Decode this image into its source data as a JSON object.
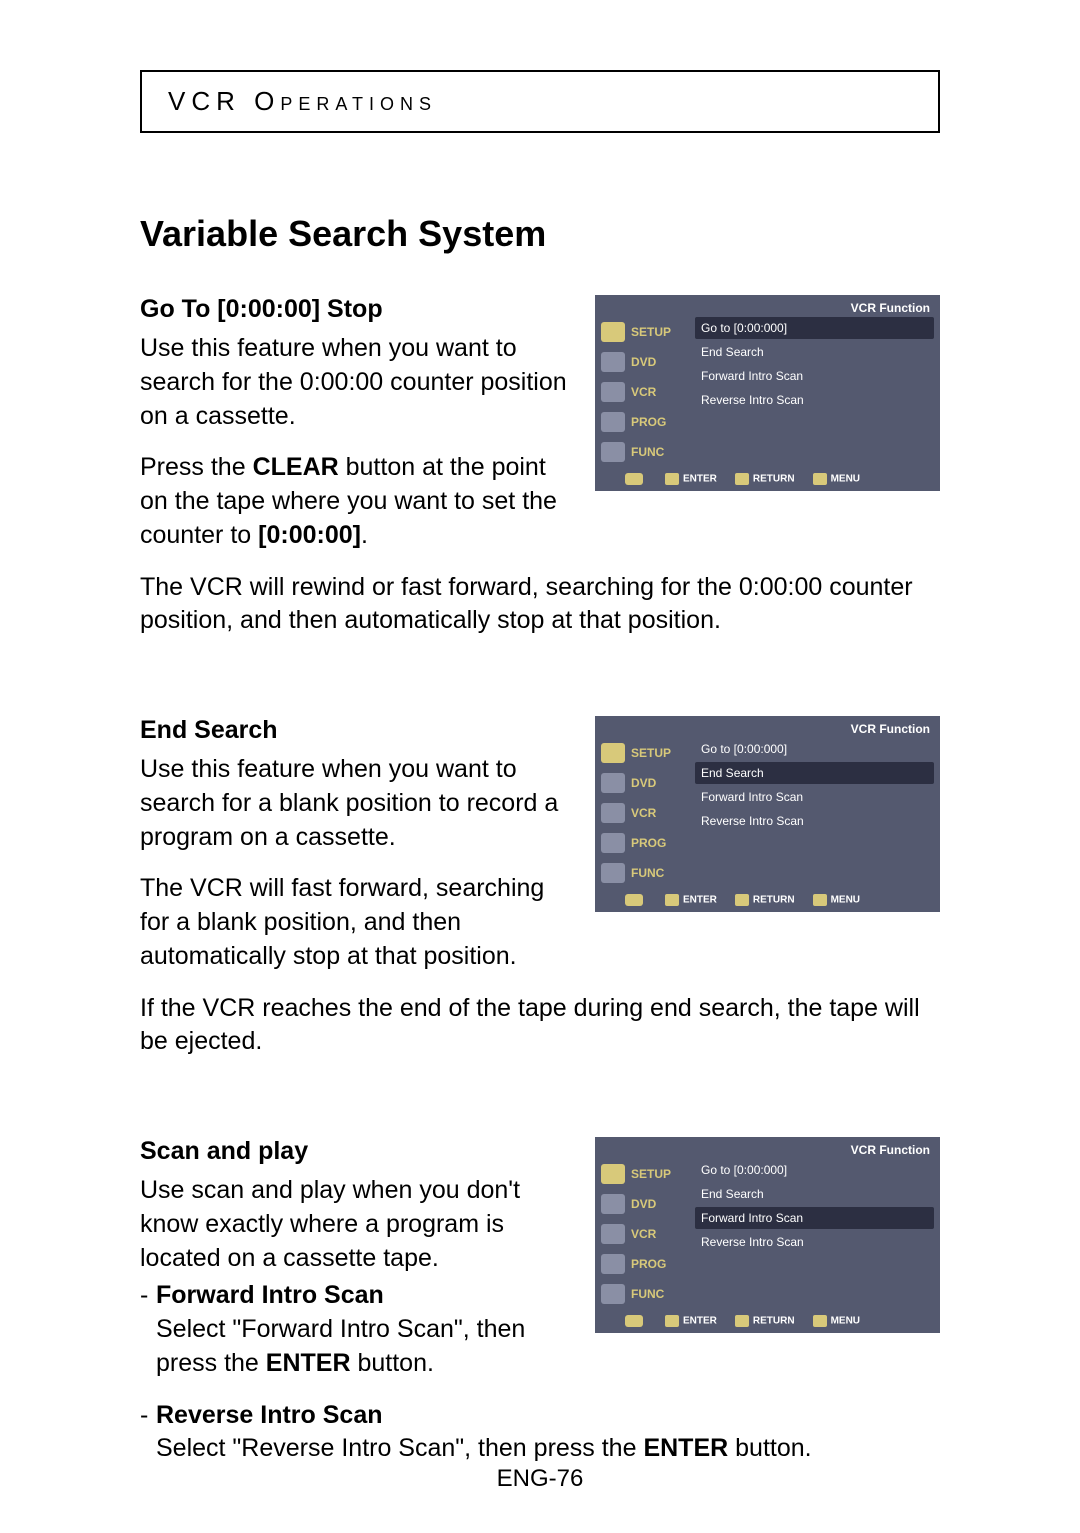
{
  "header": {
    "title": "VCR Operations"
  },
  "section_title": "Variable Search System",
  "osd": {
    "title": "VCR Function",
    "side": [
      {
        "label": "SETUP"
      },
      {
        "label": "DVD"
      },
      {
        "label": "VCR"
      },
      {
        "label": "PROG"
      },
      {
        "label": "FUNC"
      }
    ],
    "menu": [
      "Go to [0:00:000]",
      "End Search",
      "Forward Intro Scan",
      "Reverse Intro Scan"
    ],
    "footer": {
      "enter": "ENTER",
      "return": "RETURN",
      "menu": "MENU"
    }
  },
  "goto": {
    "heading": "Go To [0:00:00] Stop",
    "p1": "Use this feature when you want to search for the 0:00:00 counter position on a cassette.",
    "p2a": "Press the ",
    "p2b": "CLEAR",
    "p2c": " button at the point on the tape where you want to set the counter to ",
    "p2d": "[0:00:00]",
    "p2e": ".",
    "p3": "The VCR will rewind or fast forward, searching for the 0:00:00 counter position, and then automatically stop at that position."
  },
  "endsearch": {
    "heading": "End Search",
    "p1": "Use this feature when you want to search for a blank position to record a program on a cassette.",
    "p2": "The VCR will fast forward, searching for a blank position, and then automatically stop at that position.",
    "p3": "If the VCR reaches the end of the tape during end search, the tape will be ejected."
  },
  "scan": {
    "heading": "Scan and play",
    "p1": "Use scan and play when you don't know exactly where a program is located on a cassette tape.",
    "fwd_label": "Forward Intro Scan",
    "fwd_a": "Select \"Forward Intro Scan\", then press the ",
    "fwd_b": "ENTER",
    "fwd_c": " button.",
    "rev_label": "Reverse Intro Scan",
    "rev_a": "Select \"Reverse Intro Scan\", then press the ",
    "rev_b": "ENTER",
    "rev_c": " button."
  },
  "page_number": "ENG-76"
}
